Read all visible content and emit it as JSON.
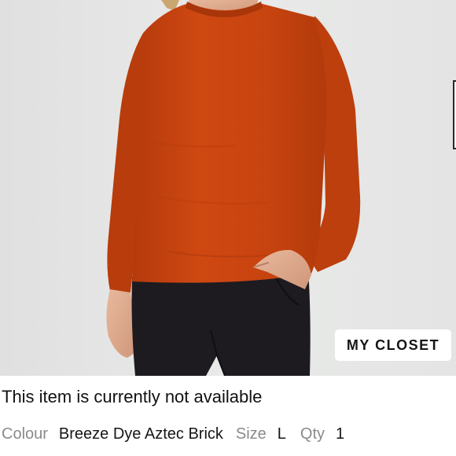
{
  "product": {
    "image_alt": "Long sleeve crew neck shirt in Breeze Dye Aztec Brick",
    "shirt_color": "#c4410f",
    "background_color": "#e6e7e6"
  },
  "actions": {
    "my_closet_label": "MY CLOSET"
  },
  "status": {
    "message": "This item is currently not available"
  },
  "details": {
    "colour_label": "Colour",
    "colour_value": "Breeze Dye Aztec Brick",
    "size_label": "Size",
    "size_value": "L",
    "qty_label": "Qty",
    "qty_value": "1"
  }
}
